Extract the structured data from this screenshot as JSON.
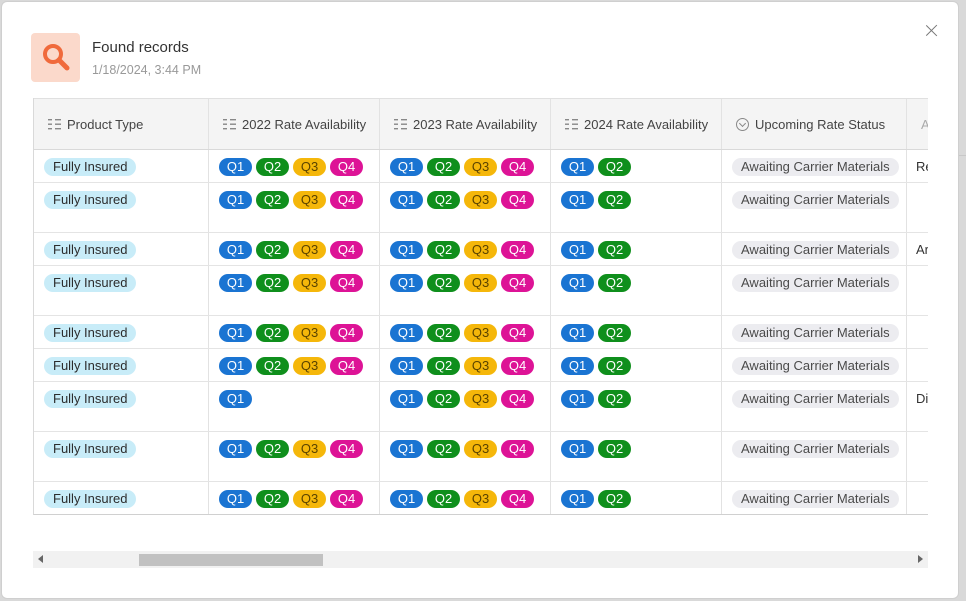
{
  "header": {
    "title": "Found records",
    "timestamp": "1/18/2024, 3:44 PM",
    "icon": "search-icon",
    "accent": "#f06a3c"
  },
  "columns": [
    {
      "label": "Product Type",
      "icon": "grid-field-icon"
    },
    {
      "label": "2022 Rate Availability",
      "icon": "grid-field-icon"
    },
    {
      "label": "2023 Rate Availability",
      "icon": "grid-field-icon"
    },
    {
      "label": "2024 Rate Availability",
      "icon": "grid-field-icon"
    },
    {
      "label": "Upcoming Rate Status",
      "icon": "status-circle-icon"
    },
    {
      "label": "A",
      "icon": ""
    }
  ],
  "quarter_colors": {
    "Q1": "#1a74d2",
    "Q2": "#0f8f1c",
    "Q3": "#f5b70a",
    "Q4": "#dd1396"
  },
  "rows": [
    {
      "product": "Fully Insured",
      "r2022": [
        "Q1",
        "Q2",
        "Q3",
        "Q4"
      ],
      "r2023": [
        "Q1",
        "Q2",
        "Q3",
        "Q4"
      ],
      "r2024": [
        "Q1",
        "Q2"
      ],
      "status": "Awaiting Carrier Materials",
      "extra": "Re"
    },
    {
      "product": "Fully Insured",
      "r2022": [
        "Q1",
        "Q2",
        "Q3",
        "Q4"
      ],
      "r2023": [
        "Q1",
        "Q2",
        "Q3",
        "Q4"
      ],
      "r2024": [
        "Q1",
        "Q2"
      ],
      "status": "Awaiting Carrier Materials",
      "extra": ""
    },
    {
      "product": "Fully Insured",
      "r2022": [
        "Q1",
        "Q2",
        "Q3",
        "Q4"
      ],
      "r2023": [
        "Q1",
        "Q2",
        "Q3",
        "Q4"
      ],
      "r2024": [
        "Q1",
        "Q2"
      ],
      "status": "Awaiting Carrier Materials",
      "extra": "Ar"
    },
    {
      "product": "Fully Insured",
      "r2022": [
        "Q1",
        "Q2",
        "Q3",
        "Q4"
      ],
      "r2023": [
        "Q1",
        "Q2",
        "Q3",
        "Q4"
      ],
      "r2024": [
        "Q1",
        "Q2"
      ],
      "status": "Awaiting Carrier Materials",
      "extra": ""
    },
    {
      "product": "Fully Insured",
      "r2022": [
        "Q1",
        "Q2",
        "Q3",
        "Q4"
      ],
      "r2023": [
        "Q1",
        "Q2",
        "Q3",
        "Q4"
      ],
      "r2024": [
        "Q1",
        "Q2"
      ],
      "status": "Awaiting Carrier Materials",
      "extra": ""
    },
    {
      "product": "Fully Insured",
      "r2022": [
        "Q1",
        "Q2",
        "Q3",
        "Q4"
      ],
      "r2023": [
        "Q1",
        "Q2",
        "Q3",
        "Q4"
      ],
      "r2024": [
        "Q1",
        "Q2"
      ],
      "status": "Awaiting Carrier Materials",
      "extra": ""
    },
    {
      "product": "Fully Insured",
      "r2022": [
        "Q1"
      ],
      "r2023": [
        "Q1",
        "Q2",
        "Q3",
        "Q4"
      ],
      "r2024": [
        "Q1",
        "Q2"
      ],
      "status": "Awaiting Carrier Materials",
      "extra": "Di"
    },
    {
      "product": "Fully Insured",
      "r2022": [
        "Q1",
        "Q2",
        "Q3",
        "Q4"
      ],
      "r2023": [
        "Q1",
        "Q2",
        "Q3",
        "Q4"
      ],
      "r2024": [
        "Q1",
        "Q2"
      ],
      "status": "Awaiting Carrier Materials",
      "extra": ""
    },
    {
      "product": "Fully Insured",
      "r2022": [
        "Q1",
        "Q2",
        "Q3",
        "Q4"
      ],
      "r2023": [
        "Q1",
        "Q2",
        "Q3",
        "Q4"
      ],
      "r2024": [
        "Q1",
        "Q2"
      ],
      "status": "Awaiting Carrier Materials",
      "extra": ""
    }
  ],
  "scrollbar": {
    "position": 0.11,
    "visible_fraction": 0.21
  }
}
